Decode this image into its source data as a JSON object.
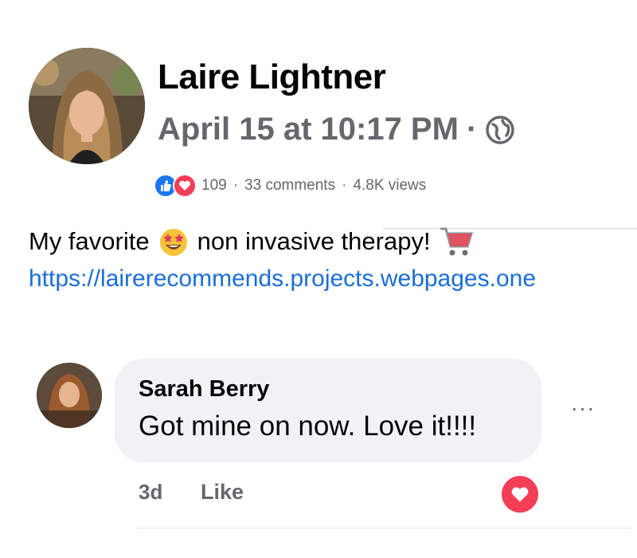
{
  "post": {
    "author": "Laire Lightner",
    "timestamp": "April 15 at 10:17 PM",
    "separator": "·",
    "audience_icon": "globe-icon",
    "reaction_icons": [
      "like-icon",
      "love-icon"
    ],
    "reaction_count": "109",
    "comments": "33 comments",
    "views": "4.8K views",
    "stats_separator": "·",
    "text_before_emoji": "My favorite",
    "emoji": "star-struck-emoji",
    "text_after_emoji": "non invasive therapy!",
    "trailing_icon": "shopping-cart-icon",
    "link": "https://lairerecommends.projects.webpages.one"
  },
  "comment": {
    "author": "Sarah Berry",
    "text": "Got mine on now. Love it!!!!",
    "time": "3d",
    "like_label": "Like",
    "more_label": "···",
    "reaction_icon": "love-icon"
  },
  "colors": {
    "like_blue": "#1877f2",
    "love_red": "#f33e58",
    "link_blue": "#1a6ed8",
    "meta_gray": "#65676b",
    "bubble_gray": "#f0f2f5"
  }
}
